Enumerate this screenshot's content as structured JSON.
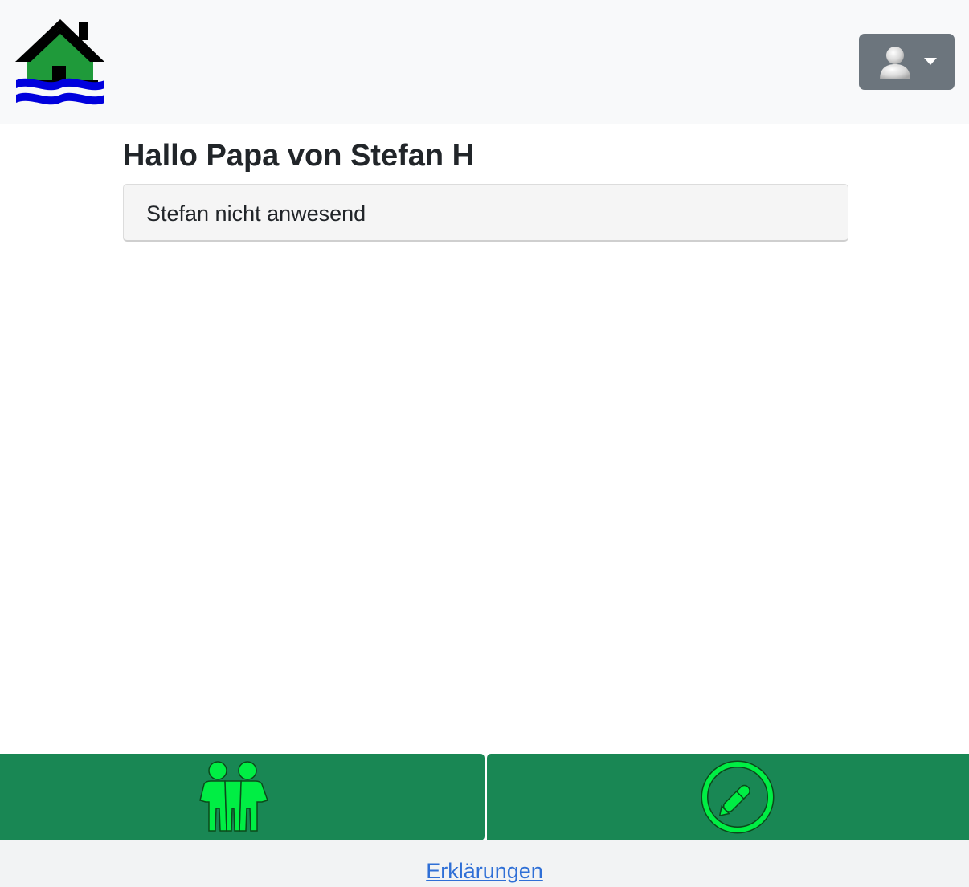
{
  "header": {
    "logo_icon": "house-flood-logo",
    "user_menu": {
      "icon": "user-avatar-icon",
      "caret": "caret-down-icon",
      "button_color": "#6c757d"
    }
  },
  "main": {
    "greeting": "Hallo Papa von Stefan H",
    "status": "Stefan nicht anwesend"
  },
  "bottom_nav": {
    "color": "#198754",
    "icon_color": "#00ee44",
    "buttons": [
      {
        "icon": "people-icon"
      },
      {
        "icon": "pen-circle-icon"
      }
    ]
  },
  "footer": {
    "link": "Erklärungen"
  }
}
